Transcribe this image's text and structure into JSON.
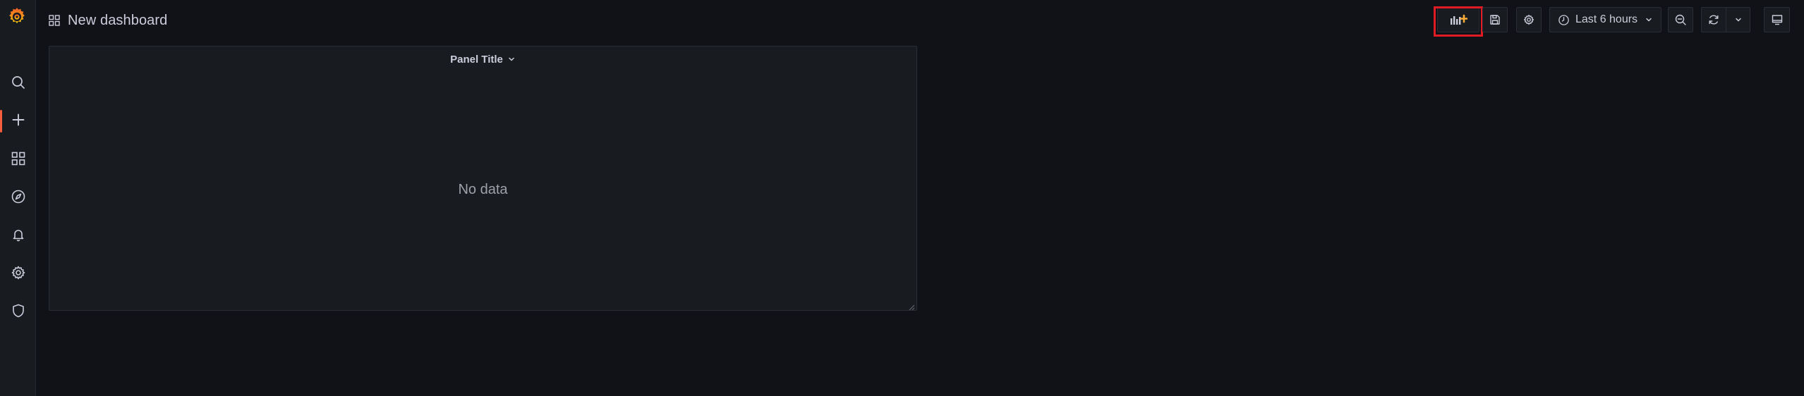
{
  "app": {
    "accent_color": "#f55f3e",
    "logo_icon": "grafana-logo-icon"
  },
  "sidebar": {
    "items": [
      {
        "name": "search",
        "icon": "search-icon"
      },
      {
        "name": "create",
        "icon": "plus-icon",
        "active": true
      },
      {
        "name": "dashboards",
        "icon": "apps-grid-icon"
      },
      {
        "name": "explore",
        "icon": "compass-icon"
      },
      {
        "name": "alerting",
        "icon": "bell-icon"
      },
      {
        "name": "configuration",
        "icon": "gear-icon"
      },
      {
        "name": "server-admin",
        "icon": "shield-icon"
      }
    ]
  },
  "header": {
    "title": "New dashboard",
    "title_icon": "apps-grid-icon"
  },
  "toolbar": {
    "add_panel_icon": "add-panel-icon",
    "save_icon": "save-icon",
    "settings_icon": "gear-icon",
    "time_range_label": "Last 6 hours",
    "zoom_out_icon": "zoom-out-icon",
    "refresh_icon": "refresh-icon",
    "refresh_dropdown_icon": "chevron-down-icon",
    "tv_mode_icon": "monitor-icon",
    "highlight_color": "#e01b24"
  },
  "panel": {
    "title": "Panel Title",
    "empty_message": "No data"
  }
}
